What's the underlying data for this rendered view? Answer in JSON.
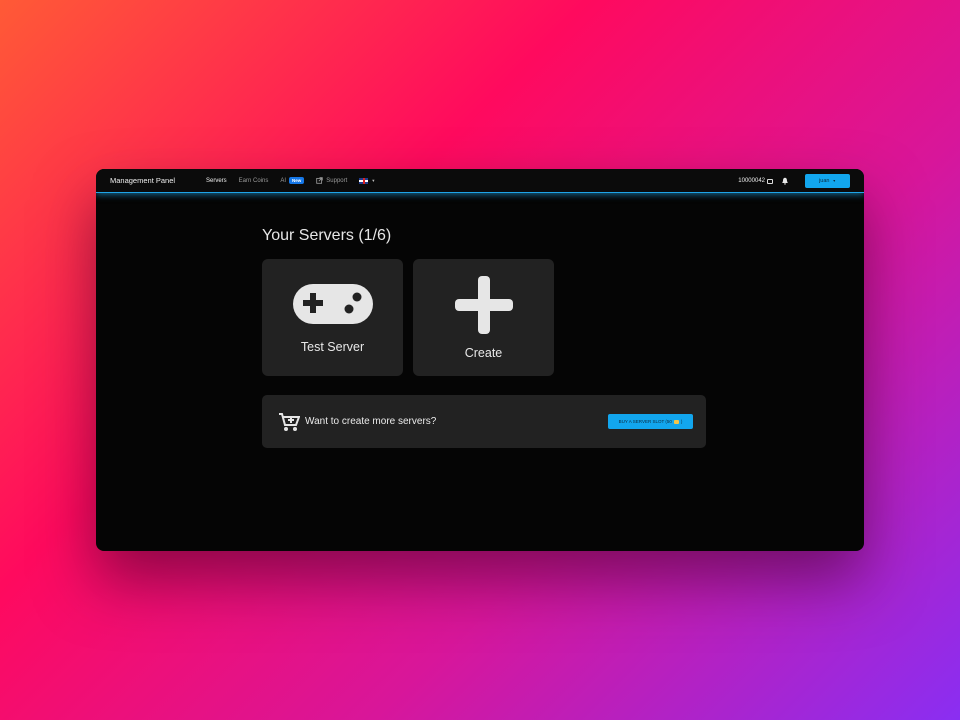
{
  "navbar": {
    "brand": "Management Panel",
    "links": [
      {
        "label": "Servers",
        "active": true
      },
      {
        "label": "Earn Coins",
        "active": false
      },
      {
        "label": "AI",
        "badge": "New",
        "active": false
      },
      {
        "label": "Support",
        "icon": "external-link-icon",
        "active": false
      }
    ],
    "language_icon": "uk-flag-icon",
    "coins": "10000042",
    "coins_icon": "coins-icon",
    "notifications_icon": "bell-icon",
    "user_label": "juan"
  },
  "main": {
    "title": "Your Servers (1/6)",
    "cards": [
      {
        "label": "Test Server",
        "icon": "gamepad-icon"
      },
      {
        "label": "Create",
        "icon": "plus-icon"
      }
    ],
    "banner": {
      "icon": "cart-plus-icon",
      "text": "Want to create more servers?",
      "button_label": "BUY A SERVER SLOT (50"
    }
  },
  "colors": {
    "accent": "#12a6ee",
    "badge": "#1577e8",
    "card_bg": "#222222",
    "window_bg": "#050505"
  }
}
